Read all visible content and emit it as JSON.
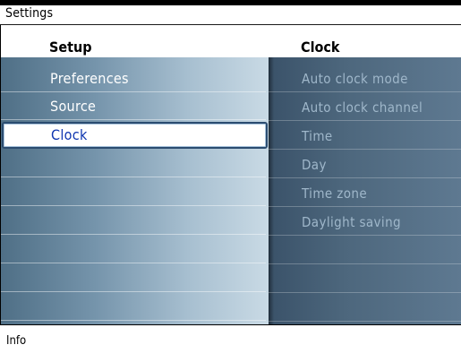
{
  "header": {
    "title": "Settings"
  },
  "columns": {
    "left_title": "Setup",
    "right_title": "Clock"
  },
  "left_menu": {
    "items": [
      {
        "label": "Preferences"
      },
      {
        "label": "Source"
      },
      {
        "label": "Clock"
      },
      {
        "label": ""
      },
      {
        "label": ""
      },
      {
        "label": ""
      },
      {
        "label": ""
      },
      {
        "label": ""
      },
      {
        "label": ""
      }
    ],
    "selected_index": 2
  },
  "right_menu": {
    "items": [
      {
        "label": "Auto clock mode"
      },
      {
        "label": "Auto clock channel"
      },
      {
        "label": "Time"
      },
      {
        "label": "Day"
      },
      {
        "label": "Time zone"
      },
      {
        "label": "Daylight saving"
      },
      {
        "label": ""
      },
      {
        "label": ""
      },
      {
        "label": ""
      }
    ]
  },
  "footer": {
    "info_label": "Info"
  }
}
